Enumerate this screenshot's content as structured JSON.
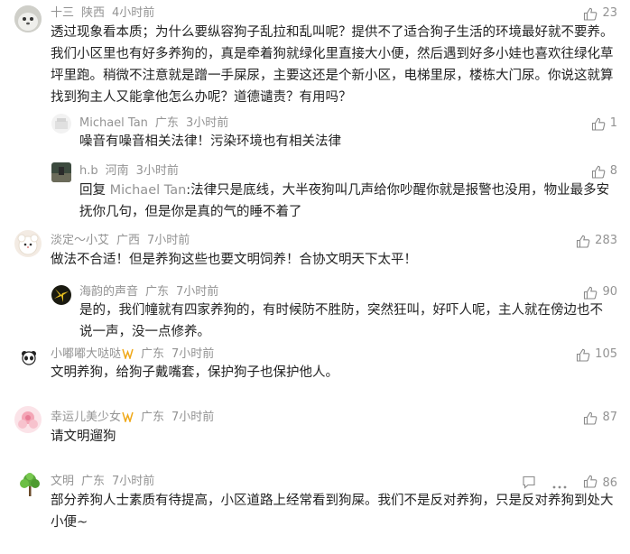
{
  "comments": [
    {
      "user": "十三",
      "location": "陕西",
      "time": "4小时前",
      "likes": "23",
      "text": "透过现象看本质；为什么要纵容狗子乱拉和乱叫呢？提供不了适合狗子生活的环境最好就不要养。我们小区里也有好多养狗的，真是牵着狗就绿化里直接大小便，然后遇到好多小娃也喜欢往绿化草坪里跑。稍微不注意就是蹭一手屎尿，主要这还是个新小区，电梯里尿，楼栋大门尿。你说这就算找到狗主人又能拿他怎么办呢？道德谴责？有用吗？",
      "replies": [
        {
          "user": "Michael Tan",
          "location": "广东",
          "time": "3小时前",
          "likes": "1",
          "text": "噪音有噪音相关法律！污染环境也有相关法律"
        },
        {
          "user": "h.b",
          "location": "河南",
          "time": "3小时前",
          "likes": "8",
          "reply_prefix": "回复",
          "reply_to": "Michael Tan",
          "text": ":法律只是底线，大半夜狗叫几声给你吵醒你就是报警也没用，物业最多安抚你几句，但是你是真的气的睡不着了"
        }
      ]
    },
    {
      "user": "淡定～小艾",
      "location": "广西",
      "time": "7小时前",
      "likes": "283",
      "text": "做法不合适！但是养狗这些也要文明饲养！合协文明天下太平！",
      "replies": [
        {
          "user": "海韵的声音",
          "location": "广东",
          "time": "7小时前",
          "likes": "90",
          "text": "是的，我们幢就有四家养狗的，有时候防不胜防，突然狂叫，好吓人呢，主人就在傍边也不说一声，没一点修养。"
        }
      ]
    },
    {
      "user": "小嘟嘟大哒哒",
      "location": "广东",
      "time": "7小时前",
      "likes": "105",
      "text": "文明养狗，给狗子戴嘴套，保护狗子也保护他人。"
    },
    {
      "user": "幸运儿美少女",
      "location": "广东",
      "time": "7小时前",
      "likes": "87",
      "text": "请文明遛狗"
    },
    {
      "user": "文明",
      "location": "广东",
      "time": "7小时前",
      "likes": "86",
      "text": "部分养狗人士素质有待提高，小区道路上经常看到狗屎。我们不是反对养狗，只是反对养狗到处大小便~"
    }
  ],
  "icons": {
    "like": "thumbs-up-icon",
    "comment": "comment-icon",
    "more": "more-icon",
    "vip_badge": "vip-badge-icon"
  },
  "colors": {
    "text": "#222222",
    "meta": "#939393",
    "badge": "#f0a818"
  }
}
